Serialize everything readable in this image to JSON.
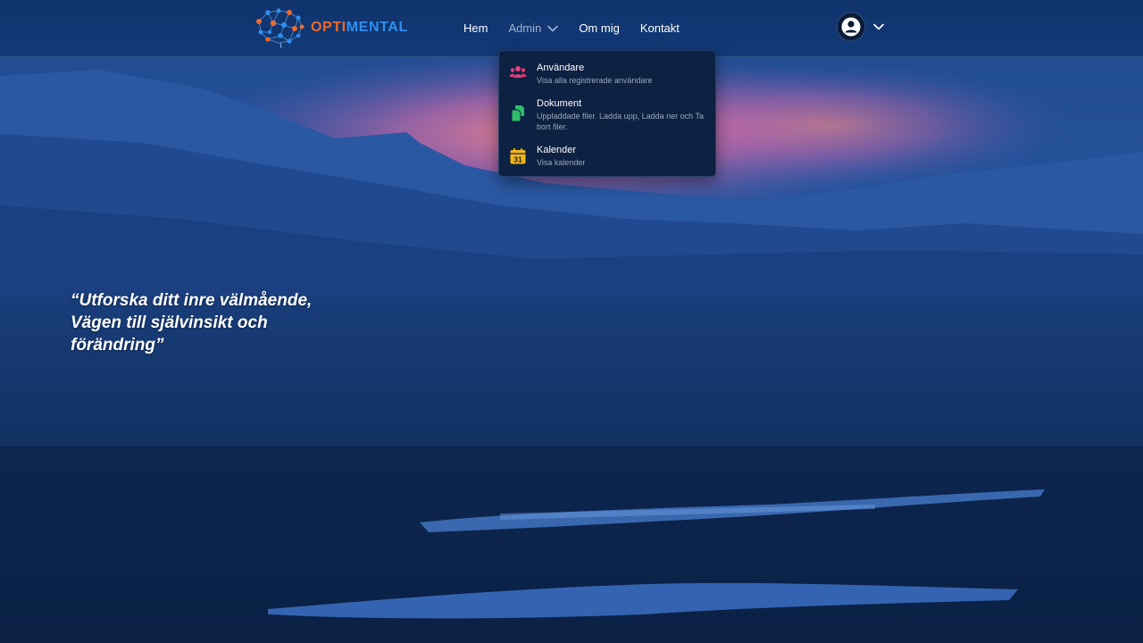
{
  "brand": {
    "name_part1": "OPTI",
    "name_part2": "MENTAL"
  },
  "nav": {
    "links": [
      {
        "label": "Hem"
      },
      {
        "label": "Admin"
      },
      {
        "label": "Om mig"
      },
      {
        "label": "Kontakt"
      }
    ],
    "active_link": "Admin"
  },
  "admin_menu": {
    "items": [
      {
        "title": "Användare",
        "description": "Visa alla registrerade användare",
        "icon": "users-icon"
      },
      {
        "title": "Dokument",
        "description": "Uppladdade filer. Ladda upp, Ladda ner och Ta bort filer.",
        "icon": "documents-icon"
      },
      {
        "title": "Kalender",
        "description": "Visa kalender",
        "icon": "calendar-icon",
        "icon_text": "31"
      }
    ]
  },
  "hero": {
    "quote_line1": "“Utforska ditt inre välmående,",
    "quote_line2": "Vägen till självinsikt och",
    "quote_line3": "förändring”"
  },
  "colors": {
    "brand_orange": "#ec6a2c",
    "brand_blue": "#2f8ff0",
    "navbar": "#123a78",
    "dropdown_bg": "#0d2142",
    "users_icon": "#e83e79",
    "documents_icon": "#2ebd6b",
    "calendar_icon": "#f2b51c"
  },
  "icons": {
    "avatar": "user-avatar-icon",
    "chevron": "chevron-down-icon",
    "logo": "brain-network-logo"
  }
}
